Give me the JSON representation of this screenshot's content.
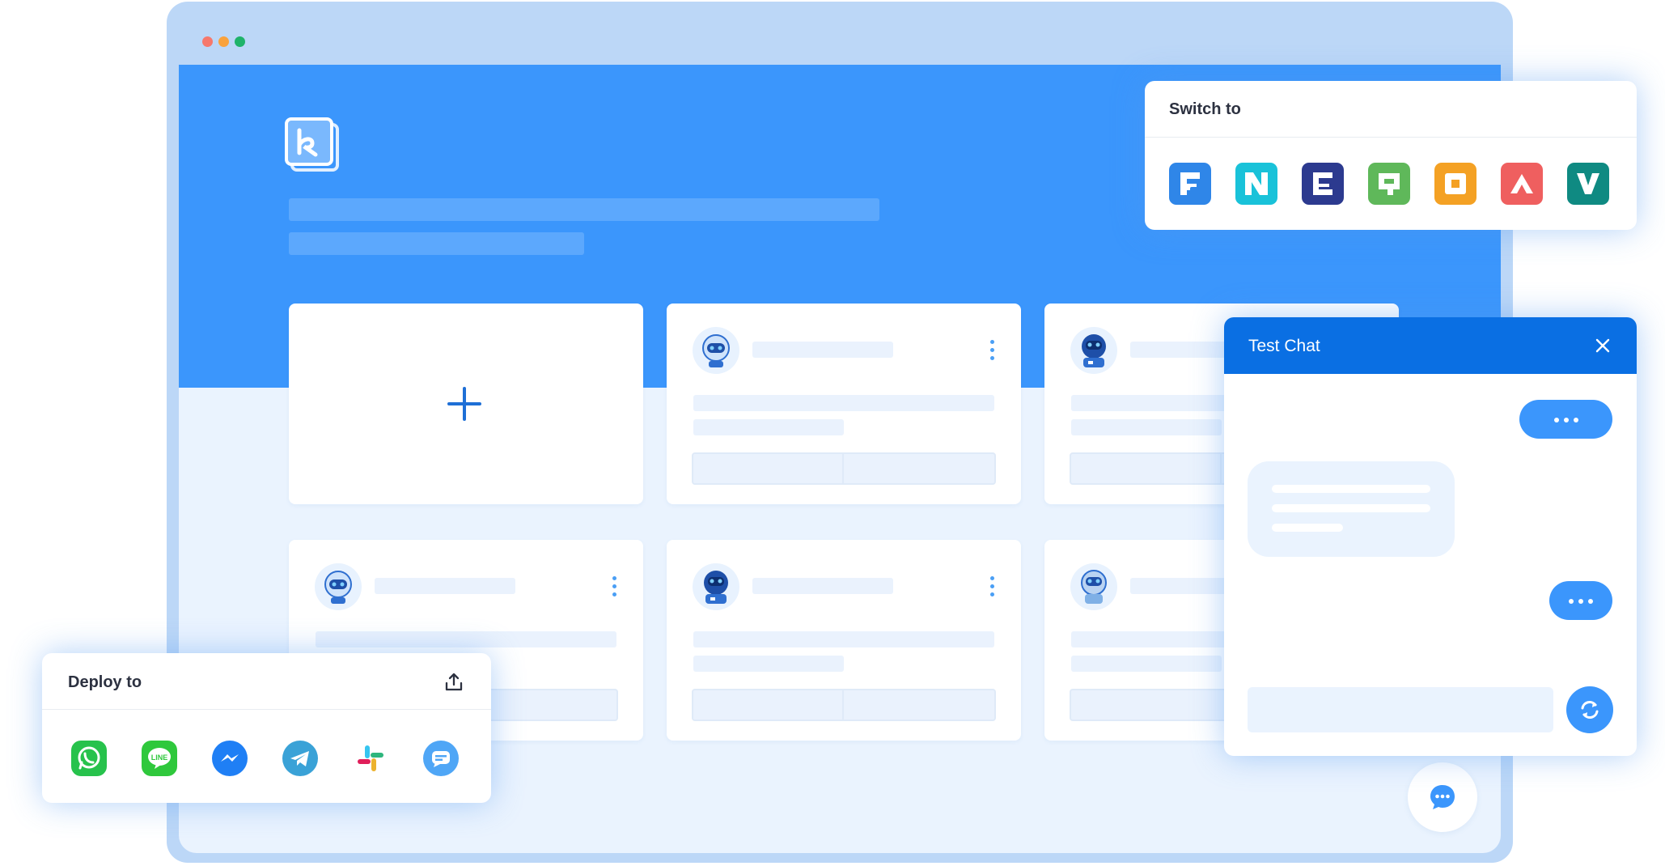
{
  "window": {
    "controls": [
      "close-dot",
      "minimize-dot",
      "maximize-dot"
    ],
    "colors": {
      "close": "#f6786c",
      "minimize": "#f9a23c",
      "maximize": "#1fb36a"
    }
  },
  "hero": {
    "logo_icon": "chat-bot-logo-icon",
    "color": "#3b96fc"
  },
  "grid": {
    "create_icon": "plus-icon",
    "cards": [
      {
        "avatar": "robot-avatar-light"
      },
      {
        "avatar": "robot-avatar-dark"
      },
      {
        "avatar": "robot-avatar-light"
      },
      {
        "avatar": "robot-avatar-dark"
      },
      {
        "avatar": "robot-avatar-grey"
      }
    ]
  },
  "switch_to": {
    "title": "Switch to",
    "brands": [
      {
        "name": "brand-f-icon",
        "color": "#2f86e8"
      },
      {
        "name": "brand-n-icon",
        "color": "#19c2d9"
      },
      {
        "name": "brand-c-icon",
        "color": "#2c3a8f"
      },
      {
        "name": "brand-q-icon",
        "color": "#5fb85a"
      },
      {
        "name": "brand-o-icon",
        "color": "#f4a124"
      },
      {
        "name": "brand-a-icon",
        "color": "#ef5f5f"
      },
      {
        "name": "brand-v-icon",
        "color": "#0f8a82"
      }
    ]
  },
  "test_chat": {
    "title": "Test Chat",
    "header_color": "#0a6fe3",
    "send_icon": "refresh-icon"
  },
  "deploy_to": {
    "title": "Deploy to",
    "export_icon": "upload-icon",
    "channels": [
      {
        "name": "whatsapp-icon",
        "color": "#27c24c"
      },
      {
        "name": "line-icon",
        "color": "#2fc83c"
      },
      {
        "name": "messenger-icon",
        "color": "#1f7ff5"
      },
      {
        "name": "telegram-icon",
        "color": "#3aa2d7"
      },
      {
        "name": "slack-icon",
        "color": "#e01e5a"
      },
      {
        "name": "livechat-icon",
        "color": "#4fa6f6"
      }
    ]
  },
  "floating_chat_icon": "chat-bubble-icon"
}
